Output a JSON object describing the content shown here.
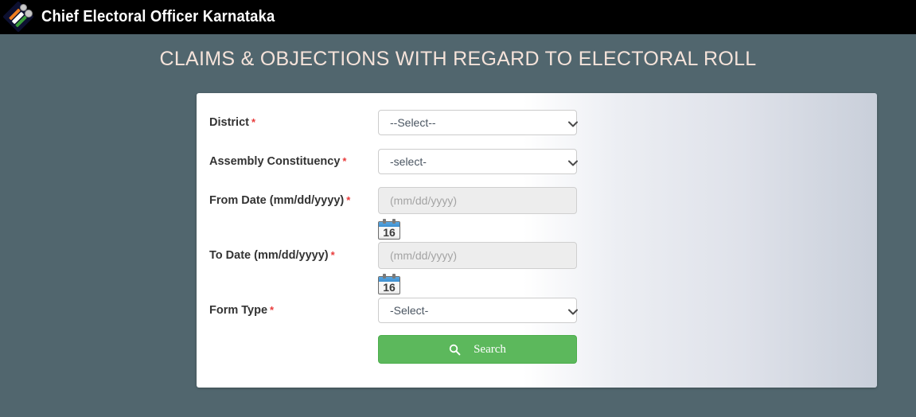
{
  "topbar": {
    "logo_name": "eci-logo",
    "title": "Chief Electoral Officer Karnataka",
    "background": "#000000"
  },
  "page": {
    "heading": "CLAIMS & OBJECTIONS WITH REGARD TO ELECTORAL ROLL",
    "background": "#51666e",
    "heading_color": "#f5e3da"
  },
  "form": {
    "required_marker": "*",
    "fields": [
      {
        "label": "District",
        "required": true,
        "type": "select",
        "value": "--Select--"
      },
      {
        "label": "Assembly Constituency",
        "required": true,
        "type": "select",
        "value": "-select-"
      },
      {
        "label": "From Date (mm/dd/yyyy)",
        "required": true,
        "type": "date",
        "value": "",
        "placeholder": "(mm/dd/yyyy)",
        "calendar_day": "16"
      },
      {
        "label": "To Date (mm/dd/yyyy)",
        "required": true,
        "type": "date",
        "value": "",
        "placeholder": "(mm/dd/yyyy)",
        "calendar_day": "16"
      },
      {
        "label": "Form Type",
        "required": true,
        "type": "select",
        "value": "-Select-"
      }
    ],
    "submit": {
      "label": "Search",
      "icon": "search-icon",
      "color": "#5cb85c"
    }
  }
}
